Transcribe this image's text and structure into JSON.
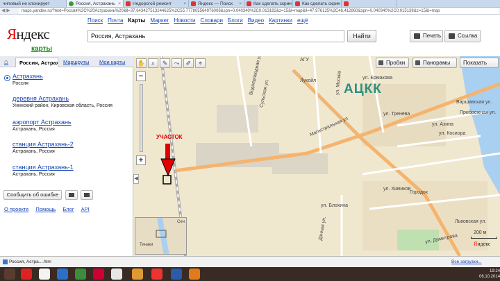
{
  "browser": {
    "tabs": [
      {
        "label": "чиповый не клонирует",
        "active": false
      },
      {
        "label": "Россия, Астрахань",
        "active": true
      },
      {
        "label": "Недорогой ремонт",
        "active": false
      },
      {
        "label": "Яндекс — Поиск",
        "active": false
      },
      {
        "label": "Как сделать скрин",
        "active": false
      },
      {
        "label": "Как сделать скрин",
        "active": false
      },
      {
        "label": "",
        "active": false
      }
    ],
    "url": "maps.yandex.ru/?text=Россия%2C%20Астрахань%20&ll=37.643427513244625%2C55.777805564976006&spn=0.040340%2C0.013182&z=15&l=map&ll=47.976125%2C46.412860&spn=0.040340%2C0.015138&z=15&l=map"
  },
  "header": {
    "logo": "Яндекс",
    "logo_first_letter": "Я",
    "logo_rest": "ндекс",
    "service": "карты",
    "nav": [
      "Поиск",
      "Почта",
      "Карты",
      "Маркет",
      "Новости",
      "Словари",
      "Блоги",
      "Видео",
      "Картинки",
      "ещё"
    ],
    "search_value": "Россия, Астрахань",
    "find_label": "Найти",
    "print_label": "Печать",
    "link_label": "Ссылка"
  },
  "sidebar": {
    "tabs": {
      "active": "Россия, Астрахань",
      "routes": "Маршруты",
      "mymaps": "Мои карты"
    },
    "results": [
      {
        "title": "Астрахань",
        "sub": "Россия"
      },
      {
        "title": "деревня Астрахань",
        "sub": "Унинский район, Кировская область, Россия"
      },
      {
        "title": "аэропорт Астрахань",
        "sub": "Астрахань, Россия"
      },
      {
        "title": "станция Астрахань-2",
        "sub": "Астрахань, Россия"
      },
      {
        "title": "станция Астрахань-1",
        "sub": "Астрахань, Россия"
      }
    ],
    "report_label": "Сообщить об ошибке",
    "footer": [
      "О проекте",
      "Помощь",
      "Блог",
      "API"
    ]
  },
  "map": {
    "buttons": {
      "traffic": "Пробки",
      "panoramas": "Панорамы",
      "show": "Показать"
    },
    "labels": {
      "agu": "АГУ",
      "lukoil": "Лукойл",
      "magistralnaya": "Магистральная ул.",
      "vodoprovodnaya": "Водопроводная ул.",
      "sulshaya": "Сульская ул.",
      "moskovskaya": "ул. Москва",
      "ermakova": "ул. Ермакова",
      "trenova": "ул. Тренёва",
      "azina": "ул. Азина",
      "kosiora": "ул. Косиора",
      "varshavskaya": "Варшавская ул.",
      "pribrezhnaya": "Прибрежная ул.",
      "khimikov": "ул. Химиков",
      "blokhina": "ул. Блохина",
      "lvovskaya": "Львовская ул.",
      "dimitrova": "ул. Димитрова",
      "gorodok": "Городок",
      "dachnaya": "Дачная ул.",
      "minimap_tinaki": "Тинаки",
      "minimap_sen": "Сен"
    },
    "watermark": "АЦКК",
    "marker_label": "УЧАСТОК",
    "scale": "200 м",
    "logo_first_letter": "Я",
    "logo_rest": "ндекс"
  },
  "downloads": {
    "item": "Россия, Астра....htm",
    "show_all": "Все загрузки..."
  },
  "taskbar": {
    "time": "19:24",
    "date": "06.10.2014"
  },
  "colors": {
    "accent_red": "#e60000",
    "link_blue": "#1746b7",
    "brand_green": "#1a8c1a",
    "map_bg": "#f0e7cf",
    "road_orange": "#f5b46e",
    "water": "#a9d0f0",
    "watermark": "#2f8f7e"
  }
}
